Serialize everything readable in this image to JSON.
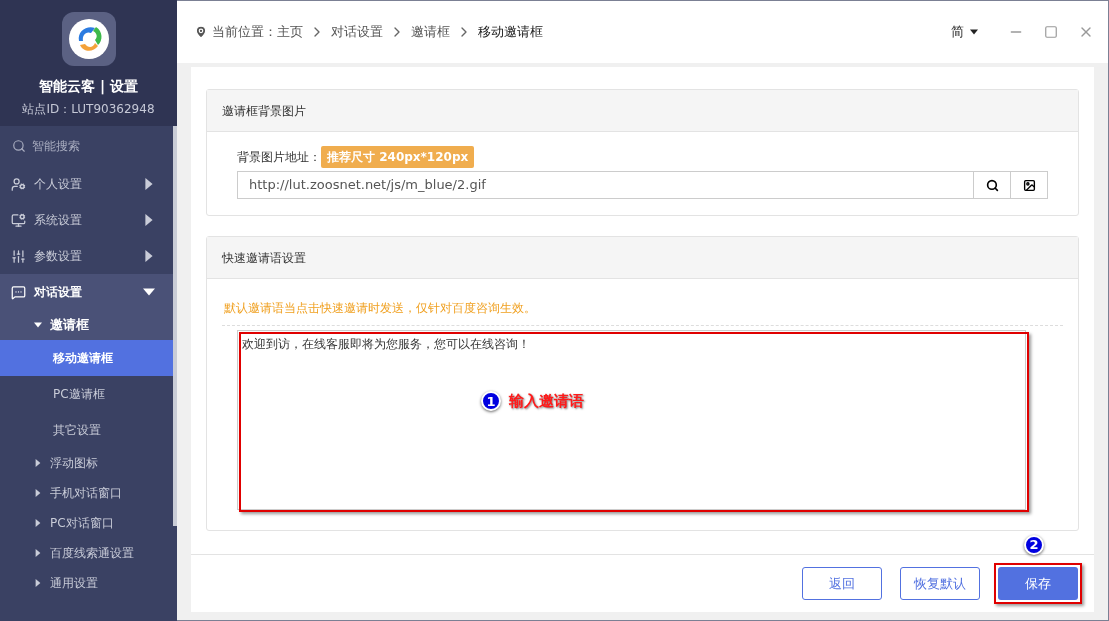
{
  "sidebar": {
    "app_title": "智能云客 | 设置",
    "site_id": "站点ID：LUT90362948",
    "search": {
      "label": "智能搜索"
    },
    "items": [
      {
        "label": "个人设置",
        "expanded": false
      },
      {
        "label": "系统设置",
        "expanded": false
      },
      {
        "label": "参数设置",
        "expanded": false
      },
      {
        "label": "对话设置",
        "expanded": true,
        "children": [
          {
            "label": "邀请框",
            "expanded": true,
            "children": [
              {
                "label": "移动邀请框",
                "selected": true
              },
              {
                "label": "PC邀请框",
                "selected": false
              },
              {
                "label": "其它设置",
                "selected": false
              }
            ]
          },
          {
            "label": "浮动图标",
            "expanded": false
          },
          {
            "label": "手机对话窗口",
            "expanded": false
          },
          {
            "label": "PC对话窗口",
            "expanded": false
          },
          {
            "label": "百度线索通设置",
            "expanded": false
          },
          {
            "label": "通用设置",
            "expanded": false
          }
        ]
      }
    ]
  },
  "breadcrumb": [
    "当前位置：主页",
    "对话设置",
    "邀请框",
    "移动邀请框"
  ],
  "language": "简",
  "background_panel": {
    "title": "邀请框背景图片",
    "field_label": "背景图片地址：",
    "badge": "推荐尺寸 240px*120px",
    "url": "http://lut.zoosnet.net/js/m_blue/2.gif"
  },
  "invite_panel": {
    "title": "快速邀请语设置",
    "hint": "默认邀请语当点击快速邀请时发送，仅针对百度咨询生效。",
    "message": "欢迎到访，在线客服即将为您服务，您可以在线咨询！"
  },
  "annotations": [
    {
      "number": "1",
      "label": "输入邀请语"
    },
    {
      "number": "2"
    }
  ],
  "buttons": [
    {
      "label": "返回",
      "kind": "outline"
    },
    {
      "label": "恢复默认",
      "kind": "outline"
    },
    {
      "label": "保存",
      "kind": "primary"
    }
  ]
}
